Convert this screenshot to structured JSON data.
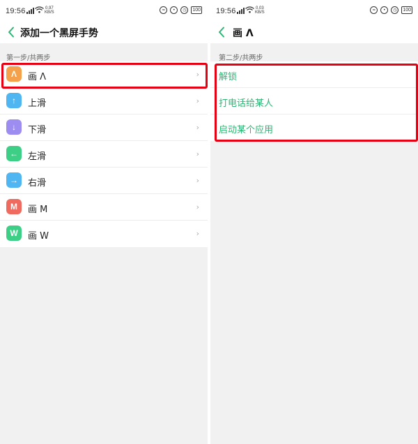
{
  "colors": {
    "accent": "#2bb673",
    "highlight": "#e60012",
    "icon_orange": "#f5a04a",
    "icon_blue": "#4fb6f2",
    "icon_purple": "#9d8df1",
    "icon_green": "#3dcf85",
    "icon_red": "#ef6a5f"
  },
  "left": {
    "status": {
      "time": "19:56",
      "speed_top": "0.97",
      "speed_bottom": "KB/S",
      "battery": "100"
    },
    "header": {
      "title": "添加一个黑屏手势"
    },
    "section_label": "第一步/共两步",
    "items": [
      {
        "icon_text": "Λ",
        "icon_name": "caret-up-icon",
        "icon_color": "#f5a04a",
        "label": "画 Λ"
      },
      {
        "icon_text": "↑",
        "icon_name": "arrow-up-icon",
        "icon_color": "#4fb6f2",
        "label": "上滑"
      },
      {
        "icon_text": "↓",
        "icon_name": "arrow-down-icon",
        "icon_color": "#9d8df1",
        "label": "下滑"
      },
      {
        "icon_text": "←",
        "icon_name": "arrow-left-icon",
        "icon_color": "#3dcf85",
        "label": "左滑"
      },
      {
        "icon_text": "→",
        "icon_name": "arrow-right-icon",
        "icon_color": "#4fb6f2",
        "label": "右滑"
      },
      {
        "icon_text": "M",
        "icon_name": "letter-m-icon",
        "icon_color": "#ef6a5f",
        "label": "画 M"
      },
      {
        "icon_text": "W",
        "icon_name": "letter-w-icon",
        "icon_color": "#3dcf85",
        "label": "画 W"
      }
    ],
    "chevron": "›"
  },
  "right": {
    "status": {
      "time": "19:56",
      "speed_top": "0.03",
      "speed_bottom": "KB/S",
      "battery": "100"
    },
    "header": {
      "title": "画 Λ"
    },
    "section_label": "第二步/共两步",
    "actions": [
      {
        "label": "解锁"
      },
      {
        "label": "打电话给某人"
      },
      {
        "label": "启动某个应用"
      }
    ]
  }
}
